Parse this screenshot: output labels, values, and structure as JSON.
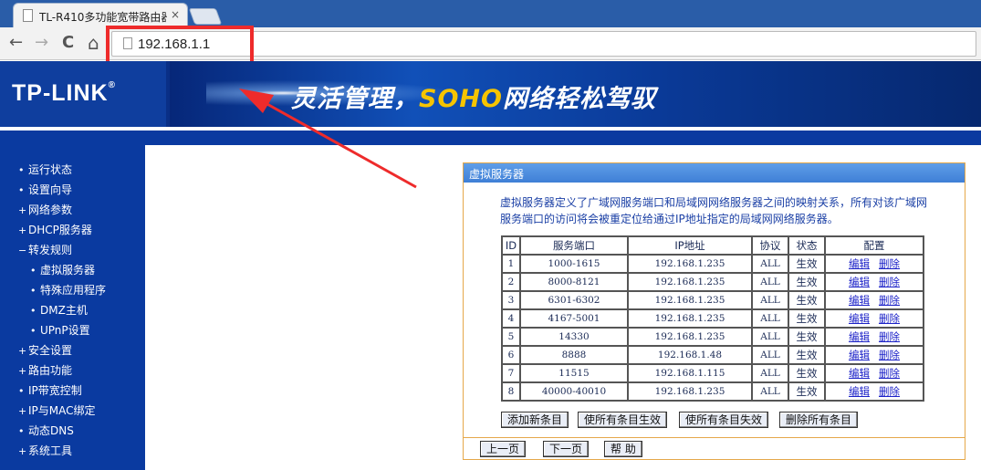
{
  "browser": {
    "tab_title": "TL-R410多功能宽带路由器",
    "tab_close": "×",
    "back": "←",
    "forward": "→",
    "reload": "C",
    "home": "⌂",
    "address": "192.168.1.1"
  },
  "header": {
    "logo": "TP-LINK",
    "logo_mark": "®",
    "slogan_pre": "灵活管理，",
    "slogan_brand": "SOHO",
    "slogan_post": "网络轻松驾驭"
  },
  "sidebar": {
    "items": [
      {
        "bullet": "•",
        "label": "运行状态"
      },
      {
        "bullet": "•",
        "label": "设置向导"
      },
      {
        "bullet": "+",
        "label": "网络参数"
      },
      {
        "bullet": "+",
        "label": "DHCP服务器"
      },
      {
        "bullet": "−",
        "label": "转发规则"
      },
      {
        "bullet": "•",
        "label": "虚拟服务器"
      },
      {
        "bullet": "•",
        "label": "特殊应用程序"
      },
      {
        "bullet": "•",
        "label": "DMZ主机"
      },
      {
        "bullet": "•",
        "label": "UPnP设置"
      },
      {
        "bullet": "+",
        "label": "安全设置"
      },
      {
        "bullet": "+",
        "label": "路由功能"
      },
      {
        "bullet": "•",
        "label": "IP带宽控制"
      },
      {
        "bullet": "+",
        "label": "IP与MAC绑定"
      },
      {
        "bullet": "•",
        "label": "动态DNS"
      },
      {
        "bullet": "+",
        "label": "系统工具"
      }
    ]
  },
  "panel": {
    "title": "虚拟服务器",
    "desc_line1": "虚拟服务器定义了广域网服务端口和局域网网络服务器之间的映射关系，所有对该广域网",
    "desc_line2": "服务端口的访问将会被重定位给通过IP地址指定的局域网网络服务器。",
    "columns": [
      "ID",
      "服务端口",
      "IP地址",
      "协议",
      "状态",
      "配置"
    ],
    "edit_label": "编辑",
    "delete_label": "删除",
    "rows": [
      {
        "id": "1",
        "port": "1000-1615",
        "ip": "192.168.1.235",
        "proto": "ALL",
        "status": "生效"
      },
      {
        "id": "2",
        "port": "8000-8121",
        "ip": "192.168.1.235",
        "proto": "ALL",
        "status": "生效"
      },
      {
        "id": "3",
        "port": "6301-6302",
        "ip": "192.168.1.235",
        "proto": "ALL",
        "status": "生效"
      },
      {
        "id": "4",
        "port": "4167-5001",
        "ip": "192.168.1.235",
        "proto": "ALL",
        "status": "生效"
      },
      {
        "id": "5",
        "port": "14330",
        "ip": "192.168.1.235",
        "proto": "ALL",
        "status": "生效"
      },
      {
        "id": "6",
        "port": "8888",
        "ip": "192.168.1.48",
        "proto": "ALL",
        "status": "生效"
      },
      {
        "id": "7",
        "port": "11515",
        "ip": "192.168.1.115",
        "proto": "ALL",
        "status": "生效"
      },
      {
        "id": "8",
        "port": "40000-40010",
        "ip": "192.168.1.235",
        "proto": "ALL",
        "status": "生效"
      }
    ],
    "buttons": {
      "add": "添加新条目",
      "enable_all": "使所有条目生效",
      "disable_all": "使所有条目失效",
      "delete_all": "删除所有条目",
      "prev": "上一页",
      "next": "下一页",
      "help": "帮 助"
    }
  },
  "colors": {
    "annotation": "#ee2b2b",
    "sidebar": "#0a3aa0",
    "panel_title": "#4a8be0",
    "slogan_brand": "#f6c400"
  }
}
